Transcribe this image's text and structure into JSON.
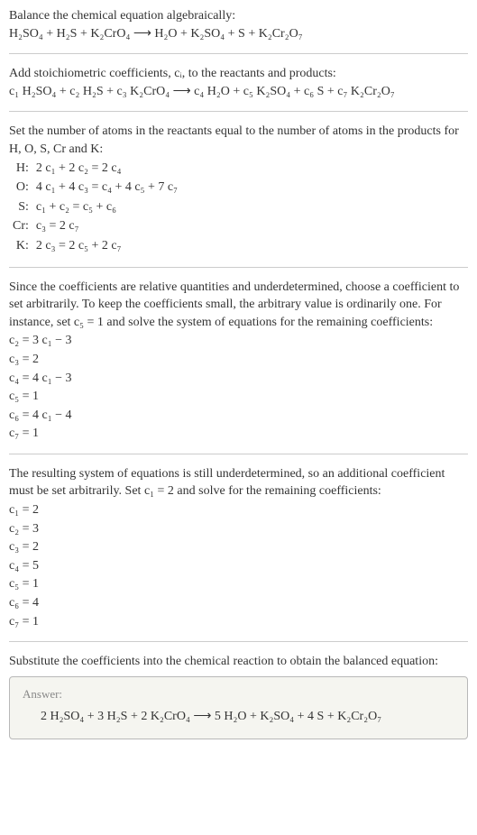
{
  "intro": {
    "line1": "Balance the chemical equation algebraically:",
    "eq": "H₂SO₄ + H₂S + K₂CrO₄ ⟶ H₂O + K₂SO₄ + S + K₂Cr₂O₇"
  },
  "step1": {
    "text": "Add stoichiometric coefficients, cᵢ, to the reactants and products:",
    "eq": "c₁ H₂SO₄ + c₂ H₂S + c₃ K₂CrO₄ ⟶ c₄ H₂O + c₅ K₂SO₄ + c₆ S + c₇ K₂Cr₂O₇"
  },
  "step2": {
    "text": "Set the number of atoms in the reactants equal to the number of atoms in the products for H, O, S, Cr and K:",
    "rows": [
      {
        "el": "H:",
        "eq": "2 c₁ + 2 c₂ = 2 c₄"
      },
      {
        "el": "O:",
        "eq": "4 c₁ + 4 c₃ = c₄ + 4 c₅ + 7 c₇"
      },
      {
        "el": "S:",
        "eq": "c₁ + c₂ = c₅ + c₆"
      },
      {
        "el": "Cr:",
        "eq": "c₃ = 2 c₇"
      },
      {
        "el": "K:",
        "eq": "2 c₃ = 2 c₅ + 2 c₇"
      }
    ]
  },
  "step3": {
    "text": "Since the coefficients are relative quantities and underdetermined, choose a coefficient to set arbitrarily. To keep the coefficients small, the arbitrary value is ordinarily one. For instance, set c₅ = 1 and solve the system of equations for the remaining coefficients:",
    "lines": [
      "c₂ = 3 c₁ − 3",
      "c₃ = 2",
      "c₄ = 4 c₁ − 3",
      "c₅ = 1",
      "c₆ = 4 c₁ − 4",
      "c₇ = 1"
    ]
  },
  "step4": {
    "text": "The resulting system of equations is still underdetermined, so an additional coefficient must be set arbitrarily. Set c₁ = 2 and solve for the remaining coefficients:",
    "lines": [
      "c₁ = 2",
      "c₂ = 3",
      "c₃ = 2",
      "c₄ = 5",
      "c₅ = 1",
      "c₆ = 4",
      "c₇ = 1"
    ]
  },
  "step5": {
    "text": "Substitute the coefficients into the chemical reaction to obtain the balanced equation:"
  },
  "answer": {
    "label": "Answer:",
    "eq": "2 H₂SO₄ + 3 H₂S + 2 K₂CrO₄ ⟶ 5 H₂O + K₂SO₄ + 4 S + K₂Cr₂O₇"
  }
}
